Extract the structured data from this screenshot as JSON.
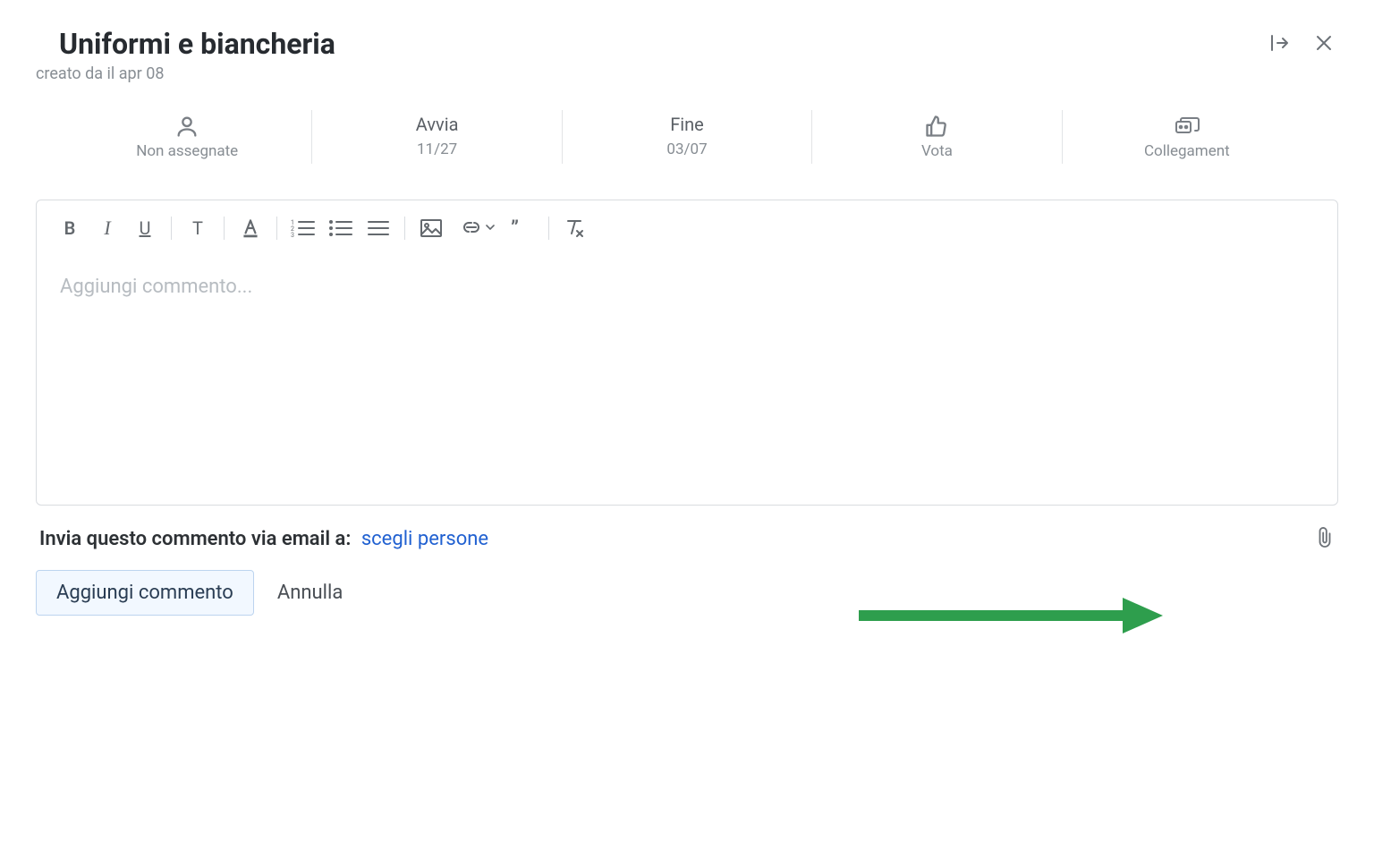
{
  "header": {
    "title": "Uniformi e biancheria",
    "created_by": "creato da il apr 08"
  },
  "summary": {
    "assigned": {
      "label": "Non assegnate"
    },
    "start": {
      "label": "Avvia",
      "value": "11/27"
    },
    "end": {
      "label": "Fine",
      "value": "03/07"
    },
    "vote": {
      "label": "Vota"
    },
    "link": {
      "label": "Collegament"
    }
  },
  "editor": {
    "placeholder": "Aggiungi commento...",
    "toolbar": {
      "bold": "B",
      "italic": "I",
      "underline": "U",
      "clearfmt": "T"
    }
  },
  "send": {
    "label": "Invia questo commento via email a:",
    "choose": "scegli persone"
  },
  "actions": {
    "submit": "Aggiungi commento",
    "cancel": "Annulla"
  }
}
